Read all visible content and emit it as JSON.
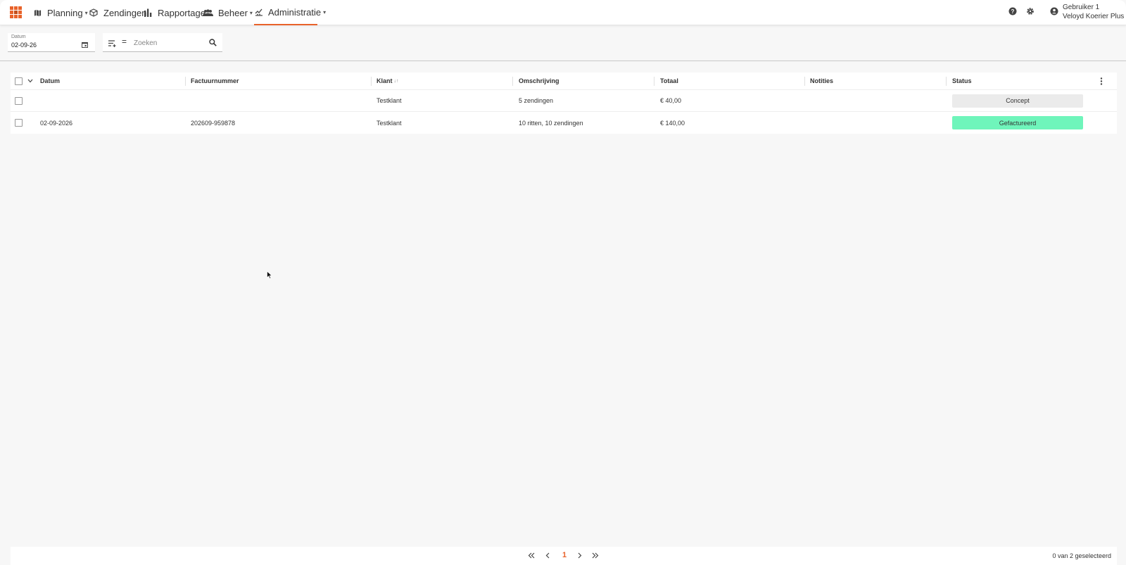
{
  "nav": {
    "items": [
      {
        "label": "Planning",
        "icon": "map-icon",
        "dropdown": true
      },
      {
        "label": "Zendingen",
        "icon": "package-icon",
        "dropdown": false
      },
      {
        "label": "Rapportage",
        "icon": "bar-chart-icon",
        "dropdown": false
      },
      {
        "label": "Beheer",
        "icon": "people-icon",
        "dropdown": true
      },
      {
        "label": "Administratie",
        "icon": "finance-icon",
        "dropdown": true,
        "active": true
      }
    ],
    "user": {
      "name": "Gebruiker 1",
      "company": "Veloyd Koerier Plus"
    },
    "accent": "#e8622a"
  },
  "filters": {
    "date_label": "Datum",
    "date_value": "02-09-26",
    "search_placeholder": "Zoeken"
  },
  "table": {
    "columns": [
      "Datum",
      "Factuurnummer",
      "Klant",
      "Omschrijving",
      "Totaal",
      "Notities",
      "Status"
    ],
    "sort_indicator": "↓↑",
    "rows": [
      {
        "datum": "",
        "factuurnummer": "",
        "klant": "Testklant",
        "omschrijving": "5 zendingen",
        "totaal": "€ 40,00",
        "notities": "",
        "status": "Concept",
        "status_color": "#ebebeb"
      },
      {
        "datum": "02-09-2026",
        "factuurnummer": "202609-959878",
        "klant": "Testklant",
        "omschrijving": "10 ritten, 10 zendingen",
        "totaal": "€ 140,00",
        "notities": "",
        "status": "Gefactureerd",
        "status_color": "#6ff5bb"
      }
    ]
  },
  "pager": {
    "current_page": "1",
    "selection_text": "0 van 2 geselecteerd"
  }
}
